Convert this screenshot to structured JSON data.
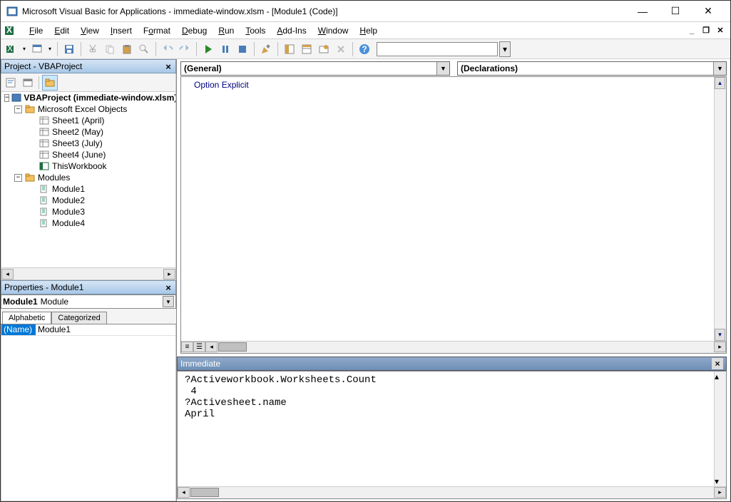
{
  "title": "Microsoft Visual Basic for Applications - immediate-window.xlsm - [Module1 (Code)]",
  "menus": {
    "file": "File",
    "edit": "Edit",
    "view": "View",
    "insert": "Insert",
    "format": "Format",
    "debug": "Debug",
    "run": "Run",
    "tools": "Tools",
    "addins": "Add-Ins",
    "window": "Window",
    "help": "Help"
  },
  "project_panel": {
    "title": "Project - VBAProject",
    "root": "VBAProject (immediate-window.xlsm)",
    "excel_objects_label": "Microsoft Excel Objects",
    "sheets": [
      "Sheet1 (April)",
      "Sheet2 (May)",
      "Sheet3 (July)",
      "Sheet4 (June)"
    ],
    "this_workbook": "ThisWorkbook",
    "modules_label": "Modules",
    "modules": [
      "Module1",
      "Module2",
      "Module3",
      "Module4"
    ]
  },
  "properties_panel": {
    "title": "Properties - Module1",
    "object_name": "Module1",
    "object_type": "Module",
    "tabs": {
      "alphabetic": "Alphabetic",
      "categorized": "Categorized"
    },
    "prop_name_label": "(Name)",
    "prop_name_value": "Module1"
  },
  "code_dropdowns": {
    "left": "(General)",
    "right": "(Declarations)"
  },
  "code_content": "Option Explicit",
  "immediate": {
    "title": "Immediate",
    "content": "?Activeworkbook.Worksheets.Count\n 4\n?Activesheet.name\nApril"
  }
}
